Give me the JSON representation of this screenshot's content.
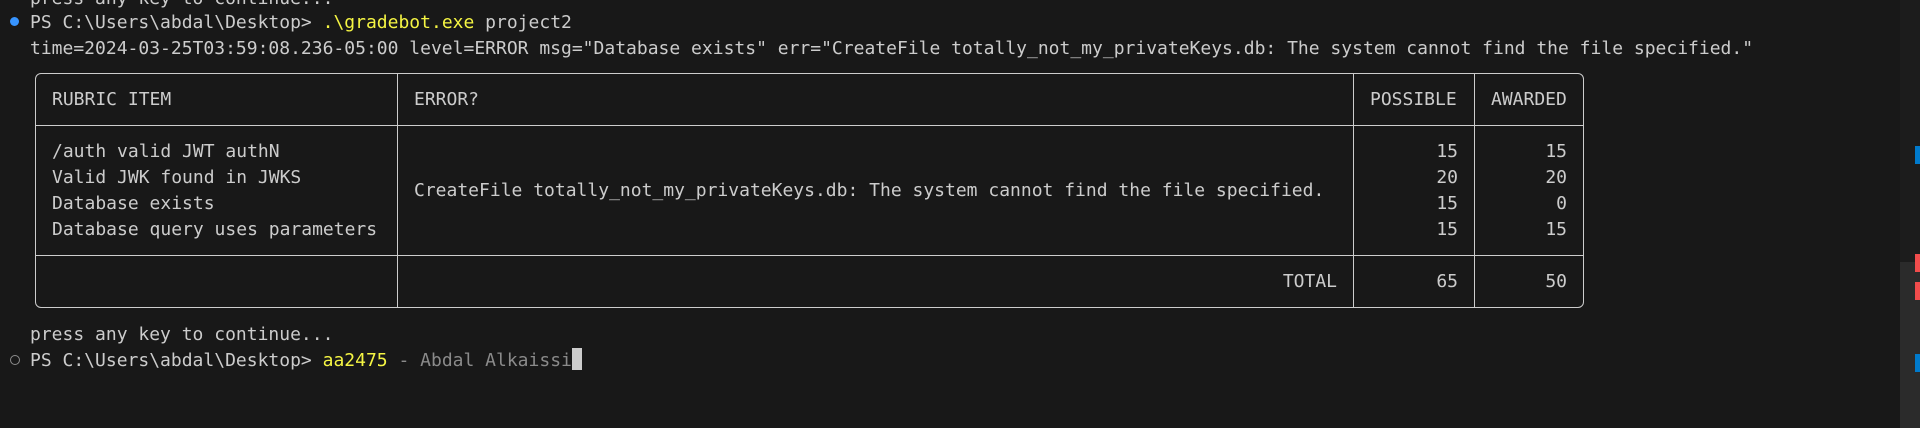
{
  "terminal": {
    "previous_line_cut": "press any key to continue...",
    "prompt": "PS C:\\Users\\abdal\\Desktop>",
    "command1_exe": ".\\gradebot.exe",
    "command1_arg": "project2",
    "log_line": "time=2024-03-25T03:59:08.236-05:00 level=ERROR msg=\"Database exists\" err=\"CreateFile totally_not_my_privateKeys.db: The system cannot find the file specified.\"",
    "continue_text": "press any key to continue...",
    "command2_main": "aa2475",
    "command2_rest": " - Abdal Alkaissi"
  },
  "table": {
    "headers": [
      "RUBRIC ITEM",
      "ERROR?",
      "POSSIBLE",
      "AWARDED"
    ],
    "items": [
      "/auth valid JWT authN",
      "Valid JWK found in JWKS",
      "Database exists",
      "Database query uses parameters"
    ],
    "error": "CreateFile totally_not_my_privateKeys.db: The system cannot find the file specified.",
    "possible": [
      "15",
      "20",
      "15",
      "15"
    ],
    "awarded": [
      "15",
      "20",
      "0",
      "15"
    ],
    "total_label": "TOTAL",
    "total_possible": "65",
    "total_awarded": "50"
  },
  "colors": {
    "background": "#181818",
    "text": "#cccccc",
    "command_highlight": "#f5f543",
    "decoration_success": "#3794ff",
    "scroll_marker_error": "#f14c4c",
    "scroll_marker_info": "#007acc"
  }
}
